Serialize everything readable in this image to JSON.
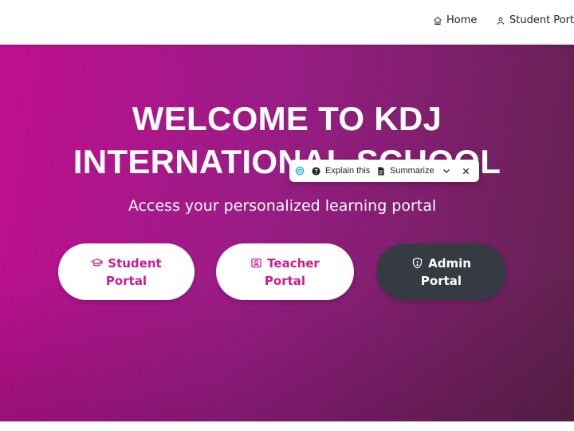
{
  "nav": {
    "links": [
      {
        "label": "Home",
        "icon": "home-icon"
      },
      {
        "label": "Student Porta",
        "icon": "user-icon"
      }
    ]
  },
  "hero": {
    "title_line1": "WELCOME TO KDJ",
    "title_line2": "INTERNATIONAL SCHOOL",
    "subtitle": "Access your personalized learning portal"
  },
  "portals": [
    {
      "line1": "Student",
      "line2": "Portal",
      "icon": "graduation-cap-icon"
    },
    {
      "line1": "Teacher",
      "line2": "Portal",
      "icon": "teacher-icon"
    },
    {
      "line1": "Admin",
      "line2": "Portal",
      "icon": "shield-icon"
    }
  ],
  "assistant_toolbar": {
    "explain_label": "Explain this",
    "summarize_label": "Summarize",
    "icons": [
      "assistant-logo-icon",
      "question-circle-icon",
      "document-icon",
      "chevron-down-icon",
      "close-icon"
    ]
  },
  "colors": {
    "accent": "#c51f92",
    "hero_start": "#c10f91",
    "hero_end": "#60224f",
    "admin_button": "#363a42"
  }
}
